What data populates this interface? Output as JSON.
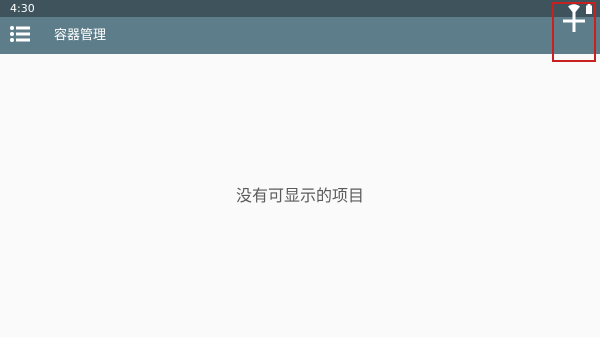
{
  "status_bar": {
    "time": "4:30",
    "icons": [
      "wifi-icon",
      "battery-icon"
    ]
  },
  "app_bar": {
    "title": "容器管理",
    "menu_icon": "list-menu-icon",
    "add_icon": "plus-icon"
  },
  "main": {
    "empty_message": "没有可显示的项目"
  },
  "colors": {
    "status_bar": "#3e535c",
    "app_bar": "#5e7d8a",
    "background": "#fafafa",
    "highlight_box": "#c8201e",
    "empty_text": "#5a5a5a"
  }
}
